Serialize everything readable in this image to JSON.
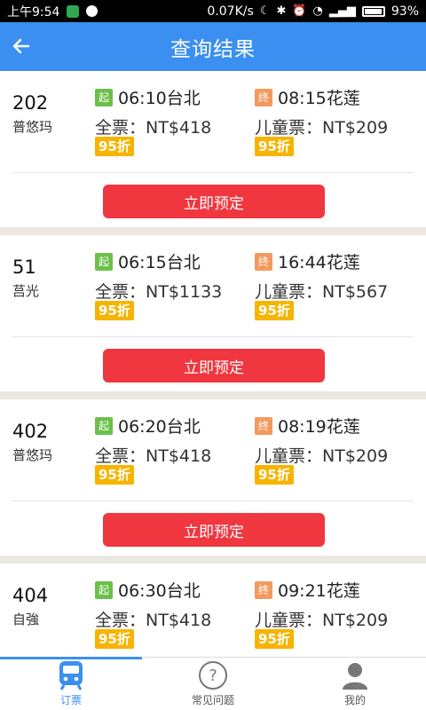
{
  "statusbar": {
    "time": "上午9:54",
    "speed": "0.07K/s",
    "battery": "93%"
  },
  "appbar": {
    "title": "查询结果"
  },
  "labels": {
    "start_tag": "起",
    "end_tag": "终",
    "book": "立即预定"
  },
  "trains": [
    {
      "number": "202",
      "type": "普悠玛",
      "depart": "06:10台北",
      "arrive": "08:15花莲",
      "full_price": "全票：NT$418",
      "child_price": "儿童票：NT$209",
      "disc1": "95折",
      "disc2": "95折"
    },
    {
      "number": "51",
      "type": "莒光",
      "depart": "06:15台北",
      "arrive": "16:44花莲",
      "full_price": "全票：NT$1133",
      "child_price": "儿童票：NT$567",
      "disc1": "95折",
      "disc2": "95折"
    },
    {
      "number": "402",
      "type": "普悠玛",
      "depart": "06:20台北",
      "arrive": "08:19花莲",
      "full_price": "全票：NT$418",
      "child_price": "儿童票：NT$209",
      "disc1": "95折",
      "disc2": "95折"
    },
    {
      "number": "404",
      "type": "自強",
      "depart": "06:30台北",
      "arrive": "09:21花莲",
      "full_price": "全票：NT$418",
      "child_price": "儿童票：NT$209",
      "disc1": "95折",
      "disc2": "95折"
    }
  ],
  "tabbar": {
    "tabs": [
      {
        "label": "订票"
      },
      {
        "label": "常见问题"
      },
      {
        "label": "我的"
      }
    ]
  },
  "colors": {
    "accent": "#3a8ff0",
    "button": "#f0363f",
    "discount": "#f6b400"
  }
}
